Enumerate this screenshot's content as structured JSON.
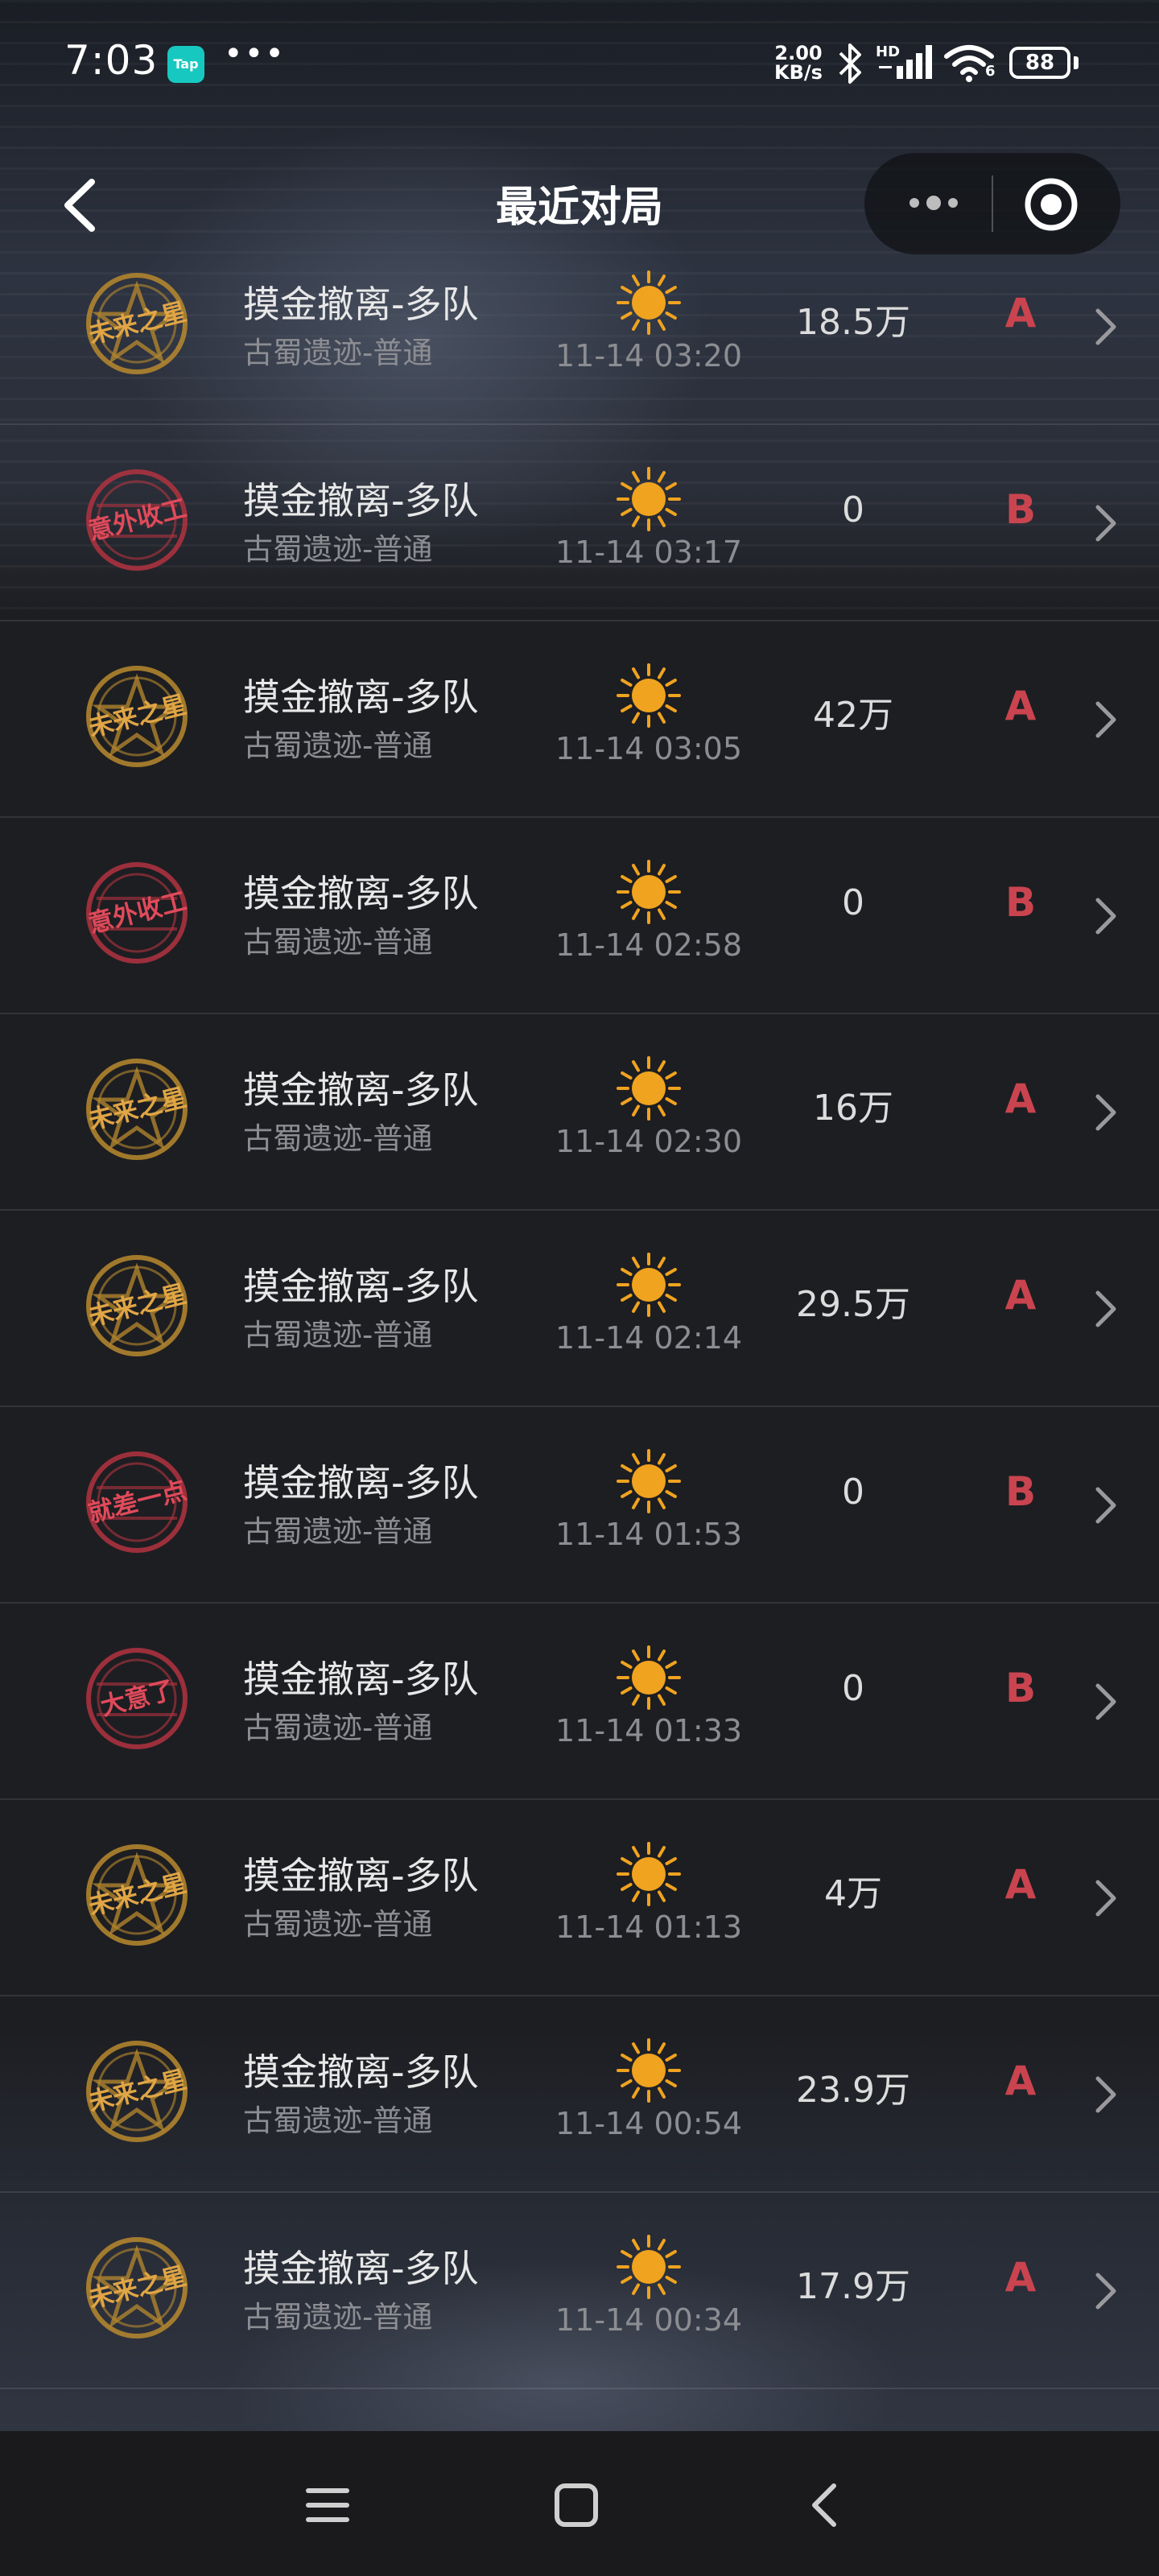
{
  "status_bar": {
    "time": "7:03",
    "app_badge": "Tap",
    "overflow": "•••",
    "net_speed_value": "2.00",
    "net_speed_unit": "KB/s",
    "signal_label": "HD",
    "wifi_label": "6",
    "battery": "88"
  },
  "header": {
    "title": "最近对局",
    "icons": {
      "back": "chevron-left-icon",
      "more": "more-dots-icon",
      "close": "target-circle-icon"
    }
  },
  "colors": {
    "gold_badge": "#b8892e",
    "red_badge": "#b2333f",
    "grade": "#c9444f",
    "sun": "#f0a31f"
  },
  "matches": [
    {
      "badge": "未来之星",
      "badge_color": "gold",
      "mode": "摸金撤离-多队",
      "map": "古蜀遗迹-普通",
      "icon": "sun-icon",
      "time": "11-14 03:20",
      "value": "18.5万",
      "grade": "A"
    },
    {
      "badge": "意外收工",
      "badge_color": "red",
      "mode": "摸金撤离-多队",
      "map": "古蜀遗迹-普通",
      "icon": "sun-icon",
      "time": "11-14 03:17",
      "value": "0",
      "grade": "B"
    },
    {
      "badge": "未来之星",
      "badge_color": "gold",
      "mode": "摸金撤离-多队",
      "map": "古蜀遗迹-普通",
      "icon": "sun-icon",
      "time": "11-14 03:05",
      "value": "42万",
      "grade": "A"
    },
    {
      "badge": "意外收工",
      "badge_color": "red",
      "mode": "摸金撤离-多队",
      "map": "古蜀遗迹-普通",
      "icon": "sun-icon",
      "time": "11-14 02:58",
      "value": "0",
      "grade": "B"
    },
    {
      "badge": "未来之星",
      "badge_color": "gold",
      "mode": "摸金撤离-多队",
      "map": "古蜀遗迹-普通",
      "icon": "sun-icon",
      "time": "11-14 02:30",
      "value": "16万",
      "grade": "A"
    },
    {
      "badge": "未来之星",
      "badge_color": "gold",
      "mode": "摸金撤离-多队",
      "map": "古蜀遗迹-普通",
      "icon": "sun-icon",
      "time": "11-14 02:14",
      "value": "29.5万",
      "grade": "A"
    },
    {
      "badge": "就差一点",
      "badge_color": "red",
      "mode": "摸金撤离-多队",
      "map": "古蜀遗迹-普通",
      "icon": "sun-icon",
      "time": "11-14 01:53",
      "value": "0",
      "grade": "B"
    },
    {
      "badge": "大意了",
      "badge_color": "red",
      "mode": "摸金撤离-多队",
      "map": "古蜀遗迹-普通",
      "icon": "sun-icon",
      "time": "11-14 01:33",
      "value": "0",
      "grade": "B"
    },
    {
      "badge": "未来之星",
      "badge_color": "gold",
      "mode": "摸金撤离-多队",
      "map": "古蜀遗迹-普通",
      "icon": "sun-icon",
      "time": "11-14 01:13",
      "value": "4万",
      "grade": "A"
    },
    {
      "badge": "未来之星",
      "badge_color": "gold",
      "mode": "摸金撤离-多队",
      "map": "古蜀遗迹-普通",
      "icon": "sun-icon",
      "time": "11-14 00:54",
      "value": "23.9万",
      "grade": "A"
    },
    {
      "badge": "未来之星",
      "badge_color": "gold",
      "mode": "摸金撤离-多队",
      "map": "古蜀遗迹-普通",
      "icon": "sun-icon",
      "time": "11-14 00:34",
      "value": "17.9万",
      "grade": "A"
    }
  ],
  "nav_bar": {
    "icons": [
      "menu-icon",
      "home-square-icon",
      "back-arrow-icon"
    ]
  }
}
